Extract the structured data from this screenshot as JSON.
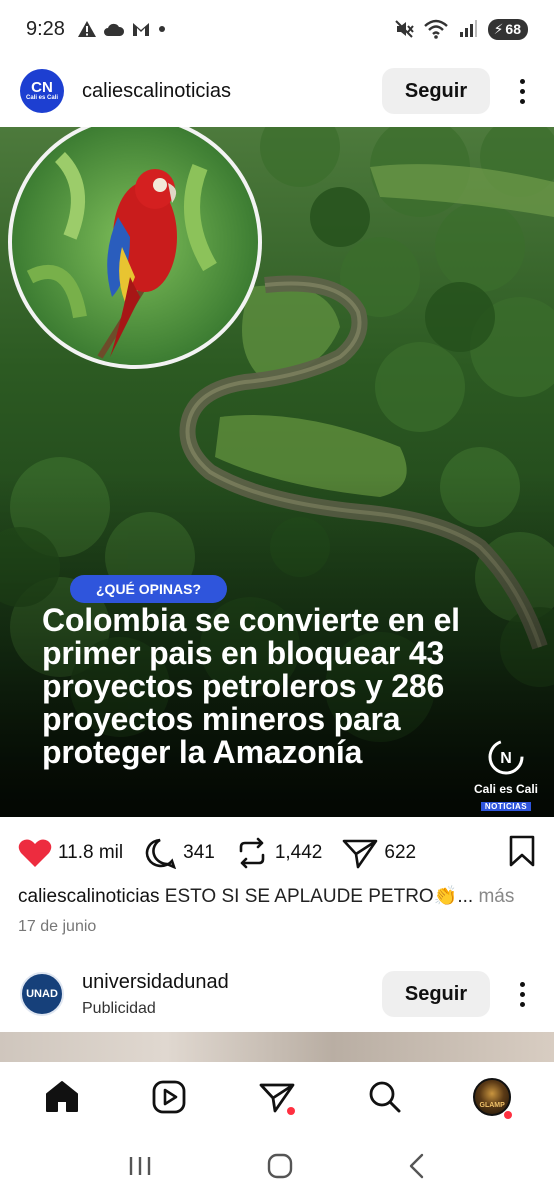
{
  "status_bar": {
    "time": "9:28",
    "battery": "68",
    "icons": [
      "alert-icon",
      "cloud-icon",
      "gmail-icon",
      "dot-icon",
      "mute-icon",
      "wifi-icon",
      "signal-icon",
      "battery-icon"
    ]
  },
  "post": {
    "username": "caliescalinoticias",
    "avatar_text": "CN",
    "avatar_small": "Cali es Cali",
    "follow_label": "Seguir",
    "image": {
      "pill": "¿QUÉ OPINAS?",
      "headline": "Colombia se convierte en el primer pais en bloquear 43 proyectos petroleros y 286 proyectos mineros para proteger la Amazonía",
      "brand_name": "Cali es Cali",
      "brand_sub": "NOTICIAS"
    },
    "likes": "11.8 mil",
    "comments": "341",
    "reposts": "1,442",
    "shares": "622",
    "caption_user": "caliescalinoticias",
    "caption_text": "ESTO SI SE APLAUDE PETRO👏...",
    "caption_more": "más",
    "date": "17 de junio"
  },
  "post2": {
    "username": "universidadunad",
    "subtitle": "Publicidad",
    "avatar_text": "UNAD",
    "follow_label": "Seguir"
  },
  "profile_avatar_text": "GLAMP",
  "colors": {
    "like": "#ed2c3f",
    "accent": "#2f55dc",
    "notification_dot": "#ff3040"
  }
}
